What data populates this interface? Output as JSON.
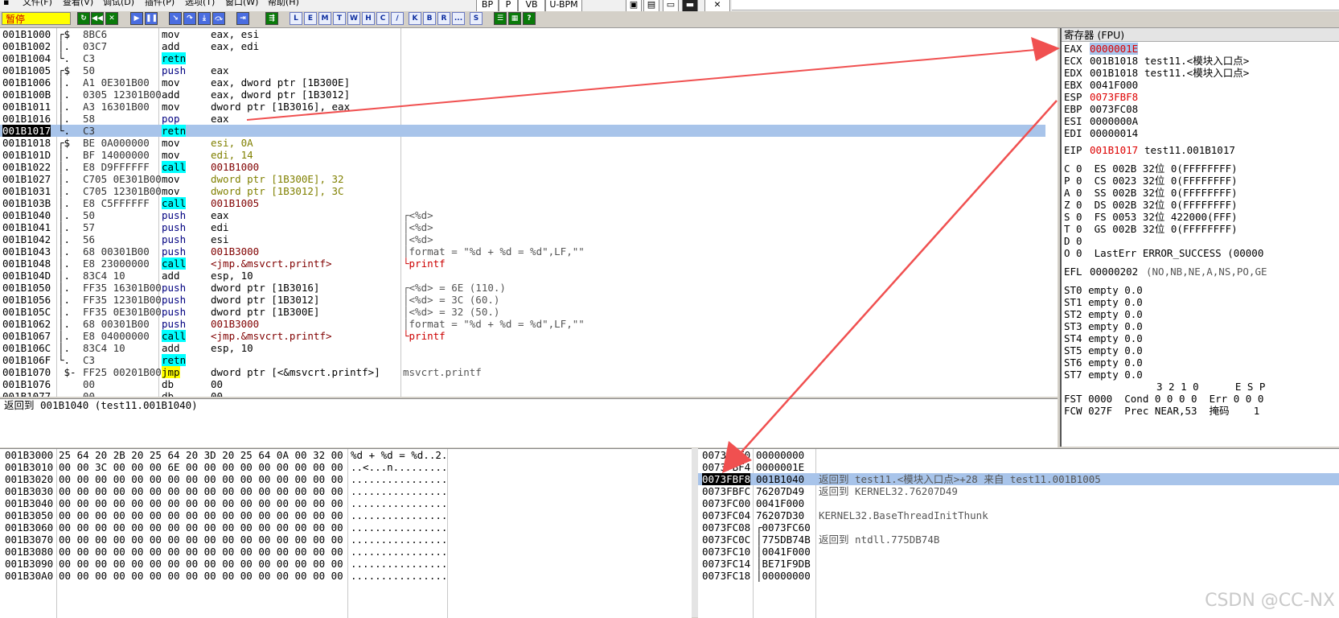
{
  "menu": {
    "items": [
      "文件(F)",
      "查看(V)",
      "调试(D)",
      "插件(P)",
      "选项(T)",
      "窗口(W)",
      "帮助(H)"
    ],
    "plugin_buttons": [
      "BP",
      "P",
      "VB",
      "U-BPM"
    ],
    "close": "✕"
  },
  "toolbar": {
    "status": "暂停",
    "letter_buttons": [
      "L",
      "E",
      "M",
      "T",
      "W",
      "H",
      "C",
      "/",
      "K",
      "B",
      "R",
      "...",
      "S"
    ]
  },
  "disasm": {
    "rows": [
      {
        "addr": "001B1000",
        "mark": "┌$",
        "hex": "8BC6",
        "mn": "mov",
        "op": "eax, esi",
        "cm": ""
      },
      {
        "addr": "001B1002",
        "mark": "│.",
        "hex": "03C7",
        "mn": "add",
        "op": "eax, edi",
        "cm": ""
      },
      {
        "addr": "001B1004",
        "mark": "└.",
        "hex": "C3",
        "mn": "retn",
        "op": "",
        "cm": ""
      },
      {
        "addr": "001B1005",
        "mark": "┌$",
        "hex": "50",
        "mn": "push",
        "op": "eax",
        "cm": ""
      },
      {
        "addr": "001B1006",
        "mark": "│.",
        "hex": "A1 0E301B00",
        "mn": "mov",
        "op": "eax, dword ptr [1B300E]",
        "cm": ""
      },
      {
        "addr": "001B100B",
        "mark": "│.",
        "hex": "0305 12301B00",
        "mn": "add",
        "op": "eax, dword ptr [1B3012]",
        "cm": ""
      },
      {
        "addr": "001B1011",
        "mark": "│.",
        "hex": "A3 16301B00",
        "mn": "mov",
        "op": "dword ptr [1B3016], eax",
        "cm": ""
      },
      {
        "addr": "001B1016",
        "mark": "│.",
        "hex": "58",
        "mn": "pop",
        "op": "eax",
        "cm": ""
      },
      {
        "addr": "001B1017",
        "mark": "└.",
        "hex": "C3",
        "mn": "retn",
        "op": "",
        "cm": ""
      },
      {
        "addr": "001B1018",
        "mark": "┌$",
        "hex": "BE 0A000000",
        "mn": "mov",
        "op": "esi, 0A",
        "cm": ""
      },
      {
        "addr": "001B101D",
        "mark": "│.",
        "hex": "BF 14000000",
        "mn": "mov",
        "op": "edi, 14",
        "cm": ""
      },
      {
        "addr": "001B1022",
        "mark": "│.",
        "hex": "E8 D9FFFFFF",
        "mn": "call",
        "op": "001B1000",
        "cm": ""
      },
      {
        "addr": "001B1027",
        "mark": "│.",
        "hex": "C705 0E301B00",
        "mn": "mov",
        "op": "dword ptr [1B300E], 32",
        "cm": ""
      },
      {
        "addr": "001B1031",
        "mark": "│.",
        "hex": "C705 12301B00",
        "mn": "mov",
        "op": "dword ptr [1B3012], 3C",
        "cm": ""
      },
      {
        "addr": "001B103B",
        "mark": "│.",
        "hex": "E8 C5FFFFFF",
        "mn": "call",
        "op": "001B1005",
        "cm": ""
      },
      {
        "addr": "001B1040",
        "mark": "│.",
        "hex": "50",
        "mn": "push",
        "op": "eax",
        "cm": "┌<%d>"
      },
      {
        "addr": "001B1041",
        "mark": "│.",
        "hex": "57",
        "mn": "push",
        "op": "edi",
        "cm": "│<%d>"
      },
      {
        "addr": "001B1042",
        "mark": "│.",
        "hex": "56",
        "mn": "push",
        "op": "esi",
        "cm": "│<%d>"
      },
      {
        "addr": "001B1043",
        "mark": "│.",
        "hex": "68 00301B00",
        "mn": "push",
        "op": "001B3000",
        "cm": "│format = \"%d + %d = %d\",LF,\"\""
      },
      {
        "addr": "001B1048",
        "mark": "│.",
        "hex": "E8 23000000",
        "mn": "call",
        "op": "<jmp.&msvcrt.printf>",
        "cm": "└printf"
      },
      {
        "addr": "001B104D",
        "mark": "│.",
        "hex": "83C4 10",
        "mn": "add",
        "op": "esp, 10",
        "cm": ""
      },
      {
        "addr": "001B1050",
        "mark": "│.",
        "hex": "FF35 16301B00",
        "mn": "push",
        "op": "dword ptr [1B3016]",
        "cm": "┌<%d> = 6E (110.)"
      },
      {
        "addr": "001B1056",
        "mark": "│.",
        "hex": "FF35 12301B00",
        "mn": "push",
        "op": "dword ptr [1B3012]",
        "cm": "│<%d> = 3C (60.)"
      },
      {
        "addr": "001B105C",
        "mark": "│.",
        "hex": "FF35 0E301B00",
        "mn": "push",
        "op": "dword ptr [1B300E]",
        "cm": "│<%d> = 32 (50.)"
      },
      {
        "addr": "001B1062",
        "mark": "│.",
        "hex": "68 00301B00",
        "mn": "push",
        "op": "001B3000",
        "cm": "│format = \"%d + %d = %d\",LF,\"\""
      },
      {
        "addr": "001B1067",
        "mark": "│.",
        "hex": "E8 04000000",
        "mn": "call",
        "op": "<jmp.&msvcrt.printf>",
        "cm": "└printf"
      },
      {
        "addr": "001B106C",
        "mark": "│.",
        "hex": "83C4 10",
        "mn": "add",
        "op": "esp, 10",
        "cm": ""
      },
      {
        "addr": "001B106F",
        "mark": "└.",
        "hex": "C3",
        "mn": "retn",
        "op": "",
        "cm": ""
      },
      {
        "addr": "001B1070",
        "mark": " $-",
        "hex": "FF25 00201B00",
        "mn": "jmp",
        "op": "dword ptr [<&msvcrt.printf>]",
        "cm": "msvcrt.printf"
      },
      {
        "addr": "001B1076",
        "mark": "",
        "hex": "00",
        "mn": "db",
        "op": "00",
        "cm": ""
      },
      {
        "addr": "001B1077",
        "mark": "",
        "hex": "00",
        "mn": "db",
        "op": "00",
        "cm": ""
      }
    ]
  },
  "info": {
    "text": "返回到 001B1040 (test11.001B1040)"
  },
  "registers": {
    "title": "寄存器 (FPU)",
    "gpr": [
      {
        "name": "EAX",
        "value": "0000001E",
        "note": ""
      },
      {
        "name": "ECX",
        "value": "001B1018",
        "note": "test11.<模块入口点>"
      },
      {
        "name": "EDX",
        "value": "001B1018",
        "note": "test11.<模块入口点>"
      },
      {
        "name": "EBX",
        "value": "0041F000",
        "note": ""
      },
      {
        "name": "ESP",
        "value": "0073FBF8",
        "note": ""
      },
      {
        "name": "EBP",
        "value": "0073FC08",
        "note": ""
      },
      {
        "name": "ESI",
        "value": "0000000A",
        "note": ""
      },
      {
        "name": "EDI",
        "value": "00000014",
        "note": ""
      }
    ],
    "eip": {
      "name": "EIP",
      "value": "001B1017",
      "note": "test11.001B1017"
    },
    "flags": [
      "C 0  ES 002B 32位 0(FFFFFFFF)",
      "P 0  CS 0023 32位 0(FFFFFFFF)",
      "A 0  SS 002B 32位 0(FFFFFFFF)",
      "Z 0  DS 002B 32位 0(FFFFFFFF)",
      "S 0  FS 0053 32位 422000(FFF)",
      "T 0  GS 002B 32位 0(FFFFFFFF)",
      "D 0",
      "O 0  LastErr ERROR_SUCCESS (00000"
    ],
    "efl": {
      "label": "EFL",
      "value": "00000202",
      "note": "(NO,NB,NE,A,NS,PO,GE"
    },
    "fpu": [
      "ST0 empty 0.0",
      "ST1 empty 0.0",
      "ST2 empty 0.0",
      "ST3 empty 0.0",
      "ST4 empty 0.0",
      "ST5 empty 0.0",
      "ST6 empty 0.0",
      "ST7 empty 0.0"
    ],
    "fpu_header": "3 2 1 0      E S P",
    "fst": "FST 0000  Cond 0 0 0 0  Err 0 0 0",
    "fcw": "FCW 027F  Prec NEAR,53  掩码    1"
  },
  "dump": {
    "rows": [
      {
        "addr": "001B3000",
        "hex": "25 64 20 2B 20 25 64 20 3D 20 25 64 0A 00 32 00",
        "ascii": "%d + %d = %d..2."
      },
      {
        "addr": "001B3010",
        "hex": "00 00 3C 00 00 00 6E 00 00 00 00 00 00 00 00 00",
        "ascii": "..<...n........."
      },
      {
        "addr": "001B3020",
        "hex": "00 00 00 00 00 00 00 00 00 00 00 00 00 00 00 00",
        "ascii": "................"
      },
      {
        "addr": "001B3030",
        "hex": "00 00 00 00 00 00 00 00 00 00 00 00 00 00 00 00",
        "ascii": "................"
      },
      {
        "addr": "001B3040",
        "hex": "00 00 00 00 00 00 00 00 00 00 00 00 00 00 00 00",
        "ascii": "................"
      },
      {
        "addr": "001B3050",
        "hex": "00 00 00 00 00 00 00 00 00 00 00 00 00 00 00 00",
        "ascii": "................"
      },
      {
        "addr": "001B3060",
        "hex": "00 00 00 00 00 00 00 00 00 00 00 00 00 00 00 00",
        "ascii": "................"
      },
      {
        "addr": "001B3070",
        "hex": "00 00 00 00 00 00 00 00 00 00 00 00 00 00 00 00",
        "ascii": "................"
      },
      {
        "addr": "001B3080",
        "hex": "00 00 00 00 00 00 00 00 00 00 00 00 00 00 00 00",
        "ascii": "................"
      },
      {
        "addr": "001B3090",
        "hex": "00 00 00 00 00 00 00 00 00 00 00 00 00 00 00 00",
        "ascii": "................"
      },
      {
        "addr": "001B30A0",
        "hex": "00 00 00 00 00 00 00 00 00 00 00 00 00 00 00 00",
        "ascii": "................"
      }
    ]
  },
  "stack": {
    "rows": [
      {
        "addr": "0073FBF0",
        "val": "00000000",
        "cm": ""
      },
      {
        "addr": "0073FBF4",
        "val": "0000001E",
        "cm": ""
      },
      {
        "addr": "0073FBF8",
        "val": "001B1040",
        "cm": "返回到 test11.<模块入口点>+28 来自 test11.001B1005"
      },
      {
        "addr": "0073FBFC",
        "val": "76207D49",
        "cm": "返回到 KERNEL32.76207D49"
      },
      {
        "addr": "0073FC00",
        "val": "0041F000",
        "cm": ""
      },
      {
        "addr": "0073FC04",
        "val": "76207D30",
        "cm": "KERNEL32.BaseThreadInitThunk"
      },
      {
        "addr": "0073FC08",
        "val": "┌0073FC60",
        "cm": ""
      },
      {
        "addr": "0073FC0C",
        "val": "│775DB74B",
        "cm": "返回到 ntdll.775DB74B"
      },
      {
        "addr": "0073FC10",
        "val": "│0041F000",
        "cm": ""
      },
      {
        "addr": "0073FC14",
        "val": "│BE71F9DB",
        "cm": ""
      },
      {
        "addr": "0073FC18",
        "val": "│00000000",
        "cm": ""
      }
    ]
  },
  "watermark": "CSDN @CC-NX",
  "colors": {
    "arrow": "#f05050",
    "selection": "#a8c4ea",
    "highlight_cyan": "#00ffff",
    "highlight_yellow": "#ffff00"
  }
}
